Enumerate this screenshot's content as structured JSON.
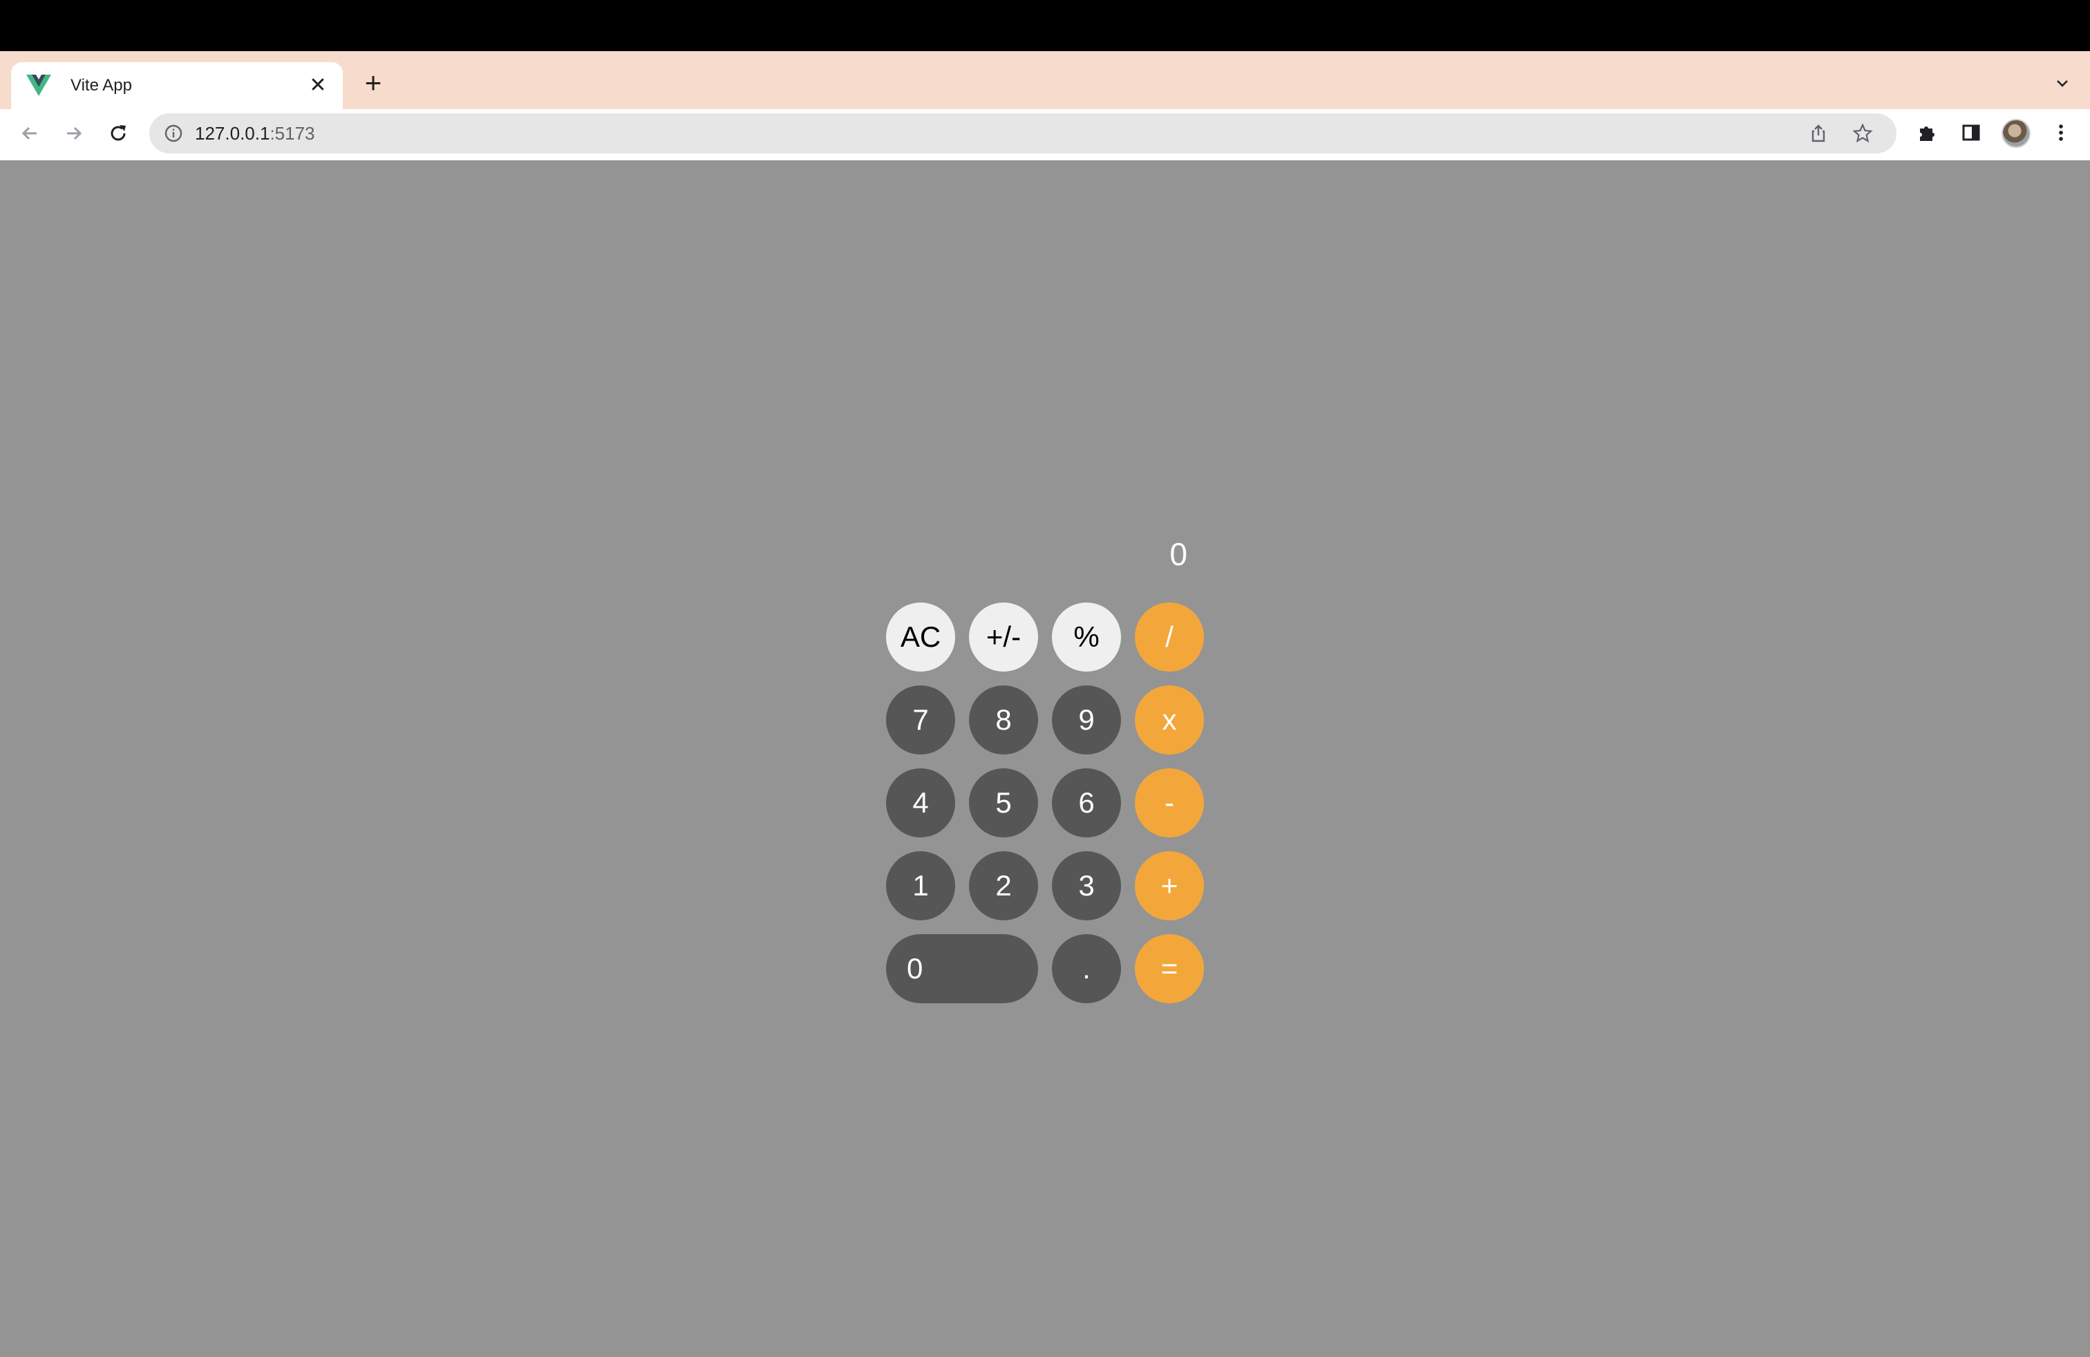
{
  "browser": {
    "tab": {
      "title": "Vite App",
      "favicon": "vue-logo-icon",
      "close_label": "✕"
    },
    "new_tab_label": "+",
    "omnibox": {
      "host": "127.0.0.1",
      "port": ":5173"
    },
    "colors": {
      "tabstrip_bg": "#f7dccd",
      "page_bg": "#949494"
    }
  },
  "calculator": {
    "display": "0",
    "rows": [
      [
        {
          "label": "AC",
          "style": "light"
        },
        {
          "label": "+/-",
          "style": "light"
        },
        {
          "label": "%",
          "style": "light"
        },
        {
          "label": "/",
          "style": "orange"
        }
      ],
      [
        {
          "label": "7",
          "style": "dark"
        },
        {
          "label": "8",
          "style": "dark"
        },
        {
          "label": "9",
          "style": "dark"
        },
        {
          "label": "x",
          "style": "orange"
        }
      ],
      [
        {
          "label": "4",
          "style": "dark"
        },
        {
          "label": "5",
          "style": "dark"
        },
        {
          "label": "6",
          "style": "dark"
        },
        {
          "label": "-",
          "style": "orange"
        }
      ],
      [
        {
          "label": "1",
          "style": "dark"
        },
        {
          "label": "2",
          "style": "dark"
        },
        {
          "label": "3",
          "style": "dark"
        },
        {
          "label": "+",
          "style": "orange"
        }
      ],
      [
        {
          "label": "0",
          "style": "dark"
        },
        {
          "label": ".",
          "style": "dark"
        },
        {
          "label": "=",
          "style": "orange"
        }
      ]
    ],
    "colors": {
      "light": "#efefef",
      "dark": "#565656",
      "orange": "#f3a73b"
    }
  }
}
